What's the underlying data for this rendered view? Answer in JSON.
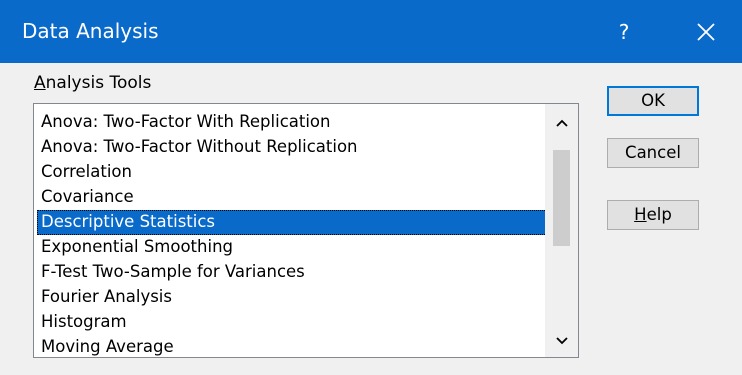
{
  "window": {
    "title": "Data Analysis",
    "help_glyph": "?",
    "close_icon": "close-icon"
  },
  "group": {
    "label_accel": "A",
    "label_rest": "nalysis Tools"
  },
  "analysis_tools": [
    "Anova: Two-Factor With Replication",
    "Anova: Two-Factor Without Replication",
    "Correlation",
    "Covariance",
    "Descriptive Statistics",
    "Exponential Smoothing",
    "F-Test Two-Sample for Variances",
    "Fourier Analysis",
    "Histogram",
    "Moving Average"
  ],
  "selected_tool": "Descriptive Statistics",
  "buttons": {
    "ok": "OK",
    "cancel": "Cancel",
    "help_accel": "H",
    "help_rest": "elp"
  },
  "colors": {
    "titlebar": "#0a6ac9",
    "selection": "#0a6ac9",
    "default_button_border": "#0078d7"
  }
}
